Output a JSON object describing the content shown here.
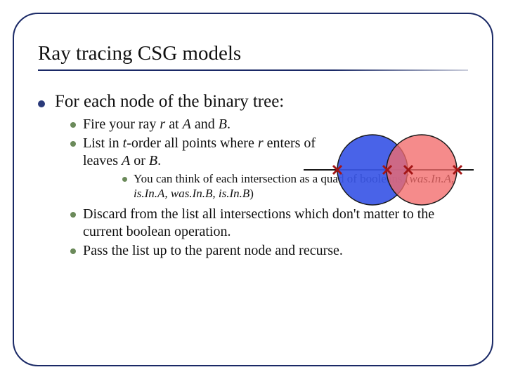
{
  "title": "Ray tracing CSG models",
  "bullet_l1": "For each node of the binary tree:",
  "sub": {
    "a_pre": "Fire your ray ",
    "a_r": "r",
    "a_mid": " at ",
    "a_A": "A",
    "a_and": " and ",
    "a_B": "B",
    "a_end": ".",
    "b_pre": "List in ",
    "b_t": "t",
    "b_mid1": "-order all points where ",
    "b_r": "r",
    "b_mid2": " enters of leaves ",
    "b_A": "A",
    "b_or": " or ",
    "b_B": "B",
    "b_end": ".",
    "c_pre": "You can think of each intersection as a quad of booleans (",
    "c_1": "was.In.A, is.In.A, was.In.B, is.In.B",
    "c_end": ")",
    "d": "Discard from the list all intersections which don't matter to the current boolean operation.",
    "e": "Pass the list up to the parent node and recurse."
  },
  "diagram": {
    "circleA_color": "#3a56e6",
    "circleB_color": "#f26a6a",
    "stroke": "#1a1a1a",
    "cross": "#a31515"
  }
}
